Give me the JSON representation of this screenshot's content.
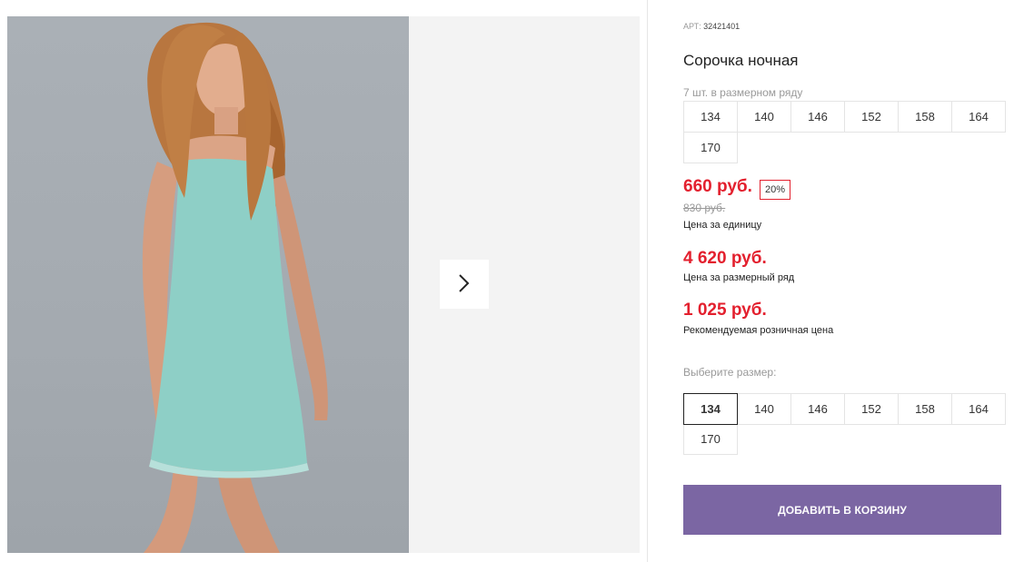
{
  "product": {
    "sku_label": "АРТ:",
    "sku_value": "32421401",
    "title": "Сорочка ночная",
    "row_note": "7 шт. в размерном ряду",
    "row_sizes": [
      "134",
      "140",
      "146",
      "152",
      "158",
      "164",
      "170"
    ]
  },
  "pricing": {
    "price": "660 руб.",
    "discount": "20%",
    "old_price": "830 руб.",
    "unit_caption": "Цена за единицу",
    "row_price": "4 620 руб.",
    "row_caption": "Цена за размерный ряд",
    "retail_price": "1 025 руб.",
    "retail_caption": "Рекомендуемая розничная цена"
  },
  "size_select": {
    "label": "Выберите размер:",
    "sizes": [
      "134",
      "140",
      "146",
      "152",
      "158",
      "164",
      "170"
    ],
    "selected": "134"
  },
  "actions": {
    "add_to_cart": "ДОБАВИТЬ В КОРЗИНУ"
  },
  "icons": {
    "next": "chevron-right-icon"
  },
  "colors": {
    "price_red": "#e3202e",
    "cart_button": "#7b66a3",
    "dress": "#8ecfc6"
  }
}
